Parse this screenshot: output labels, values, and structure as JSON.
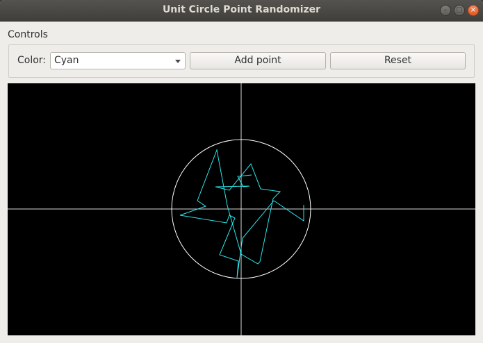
{
  "window": {
    "title": "Unit Circle Point Randomizer"
  },
  "controls": {
    "group_title": "Controls",
    "color_label": "Color:",
    "color_value": "Cyan",
    "add_label": "Add point",
    "reset_label": "Reset"
  },
  "plot": {
    "background": "#000000",
    "axis_color": "#ffffff",
    "circle_color": "#ffffff",
    "path_color": "#29e8ec",
    "points": [
      [
        0.15,
        0.49
      ],
      [
        -0.05,
        0.47
      ],
      [
        0.03,
        0.32
      ],
      [
        0.12,
        0.33
      ],
      [
        -0.37,
        0.32
      ],
      [
        -0.17,
        0.27
      ],
      [
        0.14,
        0.65
      ],
      [
        0.28,
        0.29
      ],
      [
        0.56,
        0.25
      ],
      [
        0.46,
        0.15
      ],
      [
        0.27,
        -0.76
      ],
      [
        0.24,
        -0.79
      ],
      [
        0.0,
        -0.65
      ],
      [
        -0.2,
        0.05
      ],
      [
        -0.35,
        0.85
      ],
      [
        -0.63,
        0.12
      ],
      [
        -0.51,
        0.04
      ],
      [
        -0.88,
        -0.09
      ],
      [
        -0.21,
        -0.2
      ],
      [
        -0.17,
        -0.09
      ],
      [
        -0.09,
        -0.13
      ],
      [
        -0.31,
        -0.66
      ],
      [
        -0.04,
        -0.75
      ],
      [
        -0.06,
        -0.99
      ],
      [
        0.02,
        -0.42
      ],
      [
        0.47,
        0.12
      ],
      [
        0.9,
        -0.17
      ],
      [
        0.9,
        0.06
      ]
    ]
  }
}
